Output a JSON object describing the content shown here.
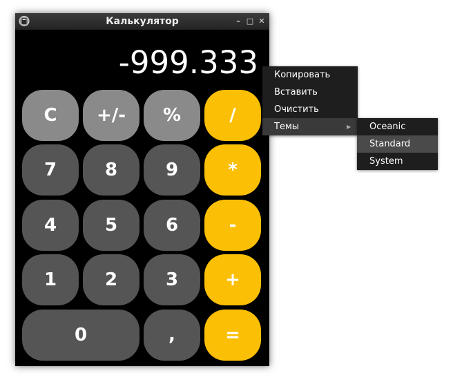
{
  "window": {
    "title": "Калькулятор",
    "controls": {
      "minimize": "–",
      "maximize": "□",
      "close": "✕"
    }
  },
  "display": {
    "value": "-999.333"
  },
  "keys": {
    "clear": "C",
    "negate": "+/-",
    "percent": "%",
    "divide": "/",
    "seven": "7",
    "eight": "8",
    "nine": "9",
    "multiply": "*",
    "four": "4",
    "five": "5",
    "six": "6",
    "subtract": "-",
    "one": "1",
    "two": "2",
    "three": "3",
    "add": "+",
    "zero": "0",
    "comma": ",",
    "equals": "="
  },
  "context_menu": {
    "items": [
      {
        "label": "Копировать"
      },
      {
        "label": "Вставить"
      },
      {
        "label": "Очистить"
      },
      {
        "label": "Темы",
        "has_submenu": true,
        "highlighted": true
      }
    ]
  },
  "themes_submenu": {
    "items": [
      {
        "label": "Oceanic"
      },
      {
        "label": "Standard",
        "highlighted": true
      },
      {
        "label": "System"
      }
    ]
  },
  "colors": {
    "window_bg": "#000000",
    "key_light": "#8a8a8a",
    "key_dark": "#555555",
    "key_operator": "#fbbf06",
    "menu_bg": "#1e1e1e"
  }
}
